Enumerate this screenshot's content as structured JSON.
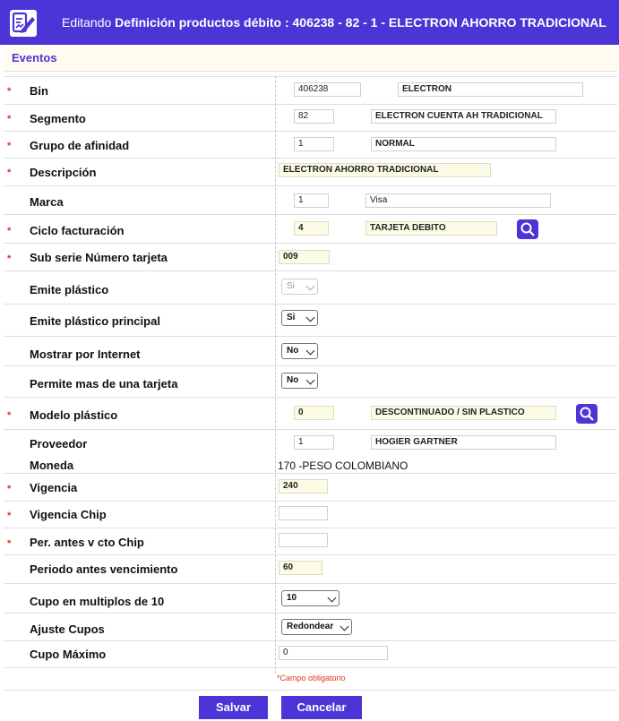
{
  "header": {
    "prefix": "Editando",
    "title": "Definición productos débito : 406238 - 82 - 1 - ELECTRON AHORRO TRADICIONAL"
  },
  "section": {
    "label": "Eventos"
  },
  "required_mark": "*",
  "fields": {
    "bin": {
      "label": "Bin",
      "code": "406238",
      "desc": "ELECTRON"
    },
    "segmento": {
      "label": "Segmento",
      "code": "82",
      "desc": "ELECTRON CUENTA AH TRADICIONAL"
    },
    "grupo": {
      "label": "Grupo de afinidad",
      "code": "1",
      "desc": "NORMAL"
    },
    "descripcion": {
      "label": "Descripción",
      "value": "ELECTRON AHORRO TRADICIONAL"
    },
    "marca": {
      "label": "Marca",
      "code": "1",
      "desc": "Visa"
    },
    "ciclo": {
      "label": "Ciclo facturación",
      "code": "4",
      "desc": "TARJETA DEBITO"
    },
    "subserie": {
      "label": "Sub serie Número tarjeta",
      "value": "009"
    },
    "emite_plastico": {
      "label": "Emite plástico",
      "value": "Si"
    },
    "emite_principal": {
      "label": "Emite plástico principal",
      "value": "Si"
    },
    "mostrar_internet": {
      "label": "Mostrar por Internet",
      "value": "No"
    },
    "permite_mas": {
      "label": "Permite mas de una tarjeta",
      "value": "No"
    },
    "modelo": {
      "label": "Modelo plástico",
      "code": "0",
      "desc": "DESCONTINUADO / SIN PLASTICO"
    },
    "proveedor": {
      "label": "Proveedor",
      "code": "1",
      "desc": "HOGIER GARTNER"
    },
    "moneda": {
      "label": "Moneda",
      "value": "170 -PESO COLOMBIANO"
    },
    "vigencia": {
      "label": "Vigencia",
      "value": "240"
    },
    "vigencia_chip": {
      "label": "Vigencia Chip",
      "value": ""
    },
    "per_antes": {
      "label": "Per. antes v cto Chip",
      "value": ""
    },
    "periodo_antes": {
      "label": "Periodo antes vencimiento",
      "value": "60"
    },
    "cupo_multiplos": {
      "label": "Cupo en multiplos de 10",
      "value": "10"
    },
    "ajuste_cupos": {
      "label": "Ajuste Cupos",
      "value": "Redondear"
    },
    "cupo_maximo": {
      "label": "Cupo Máximo",
      "value": "0"
    }
  },
  "note": "*Campo obligatorio",
  "buttons": {
    "save": "Salvar",
    "cancel": "Cancelar"
  },
  "colors": {
    "primary": "#4b35d6",
    "required": "#e2351b",
    "section_bg": "#fffcef"
  },
  "icons": {
    "header": "edit-document-icon",
    "search": "search-icon"
  }
}
